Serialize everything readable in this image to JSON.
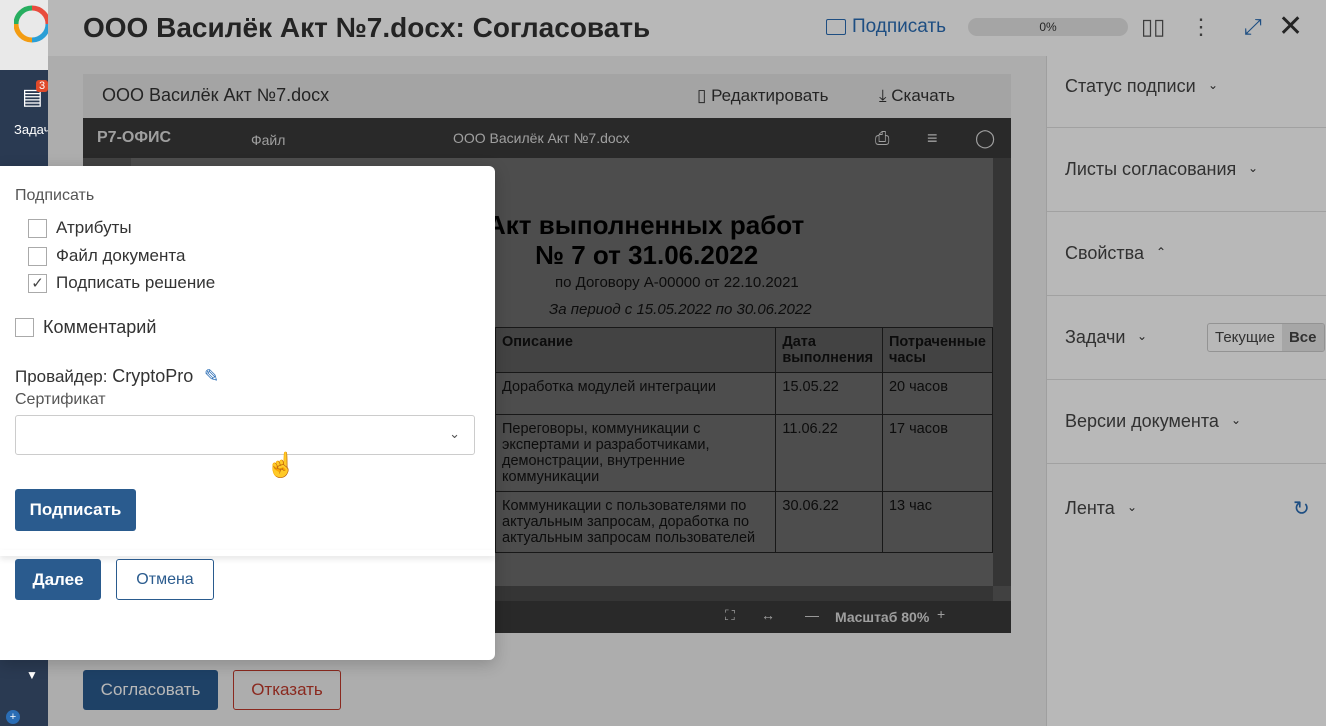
{
  "rail": {
    "tasks_label": "Задач",
    "badge": "3"
  },
  "window": {
    "title": "ООО Василёк Акт №7.docx: Согласовать",
    "sign_label": "Подписать",
    "progress": "0%"
  },
  "doc": {
    "name": "ООО Василёк Акт №7.docx",
    "edit_label": "Редактировать",
    "download_label": "Скачать"
  },
  "viewer": {
    "brand": "Р7-ОФИС",
    "file_menu": "Файл",
    "doc_title": "ООО Василёк Акт №7.docx",
    "zoom_label": "Масштаб 80%",
    "heading1": "Акт выполненных работ",
    "heading2": "№ 7 от 31.06.2022",
    "contract": "по Договору А-00000 от 22.10.2021",
    "period": "За период с 15.05.2022 по 30.06.2022",
    "table": {
      "headers": [
        "Описание",
        "Дата выполнения",
        "Потраченные часы"
      ],
      "rows": [
        [
          "Доработка модулей интеграции",
          "15.05.22",
          "20 часов"
        ],
        [
          "Переговоры, коммуникации с экспертами и разработчиками, демонстрации, внутренние коммуникации",
          "11.06.22",
          "17 часов"
        ],
        [
          "Коммуникации с пользователями по актуальным запросам, доработка по актуальным запросам пользователей",
          "30.06.22",
          "13 час"
        ]
      ]
    }
  },
  "actions": {
    "approve": "Согласовать",
    "reject": "Отказать"
  },
  "right_panel": {
    "signature_status": "Статус подписи",
    "approval_sheets": "Листы согласования",
    "properties": "Свойства",
    "tasks": "Задачи",
    "tasks_current": "Текущие",
    "tasks_all": "Все",
    "versions": "Версии документа",
    "feed": "Лента"
  },
  "modal": {
    "sign_heading": "Подписать",
    "options": [
      {
        "label": "Атрибуты",
        "checked": false
      },
      {
        "label": "Файл документа",
        "checked": false
      },
      {
        "label": "Подписать решение",
        "checked": true
      }
    ],
    "comment_label": "Комментарий",
    "provider_label": "Провайдер:",
    "provider_value": "CryptoPro",
    "certificate_label": "Сертификат",
    "certificate_value": "",
    "sign_button": "Подписать",
    "next_button": "Далее",
    "cancel_button": "Отмена"
  }
}
